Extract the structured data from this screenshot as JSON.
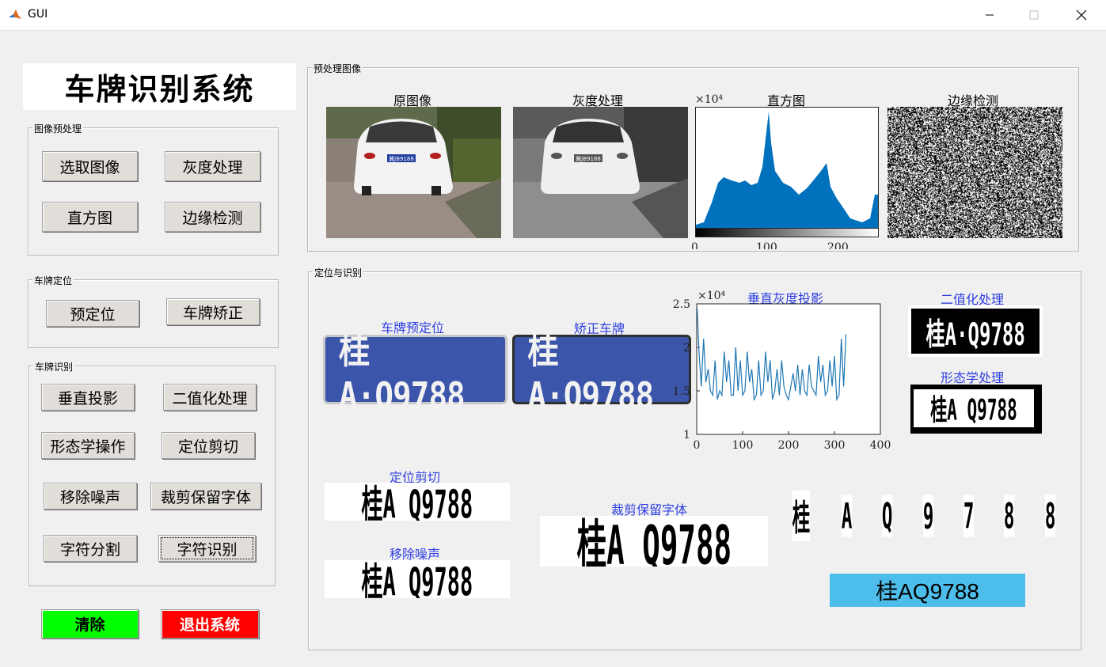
{
  "window": {
    "title": "GUI"
  },
  "app_title": "车牌识别系统",
  "panels": {
    "preprocess": "图像预处理",
    "locate": "车牌定位",
    "recognize": "车牌识别",
    "preview": "预处理图像",
    "result": "定位与识别"
  },
  "buttons": {
    "select_image": "选取图像",
    "grayscale": "灰度处理",
    "histogram": "直方图",
    "edge": "边缘检测",
    "prelocate": "预定位",
    "correct": "车牌矫正",
    "vproj": "垂直投影",
    "binarize": "二值化处理",
    "morph": "形态学操作",
    "crop": "定位剪切",
    "denoise": "移除噪声",
    "crop_keep": "裁剪保留字体",
    "segment": "字符分割",
    "recognize": "字符识别",
    "clear": "清除",
    "exit": "退出系统"
  },
  "preview_labels": {
    "original": "原图像",
    "gray": "灰度处理",
    "hist": "直方图",
    "edge": "边缘检测"
  },
  "result_labels": {
    "prelocate": "车牌预定位",
    "corrected": "矫正车牌",
    "vproj": "垂直灰度投影",
    "binary": "二值化处理",
    "morph": "形态学处理",
    "crop": "定位剪切",
    "denoise": "移除噪声",
    "crop_keep": "裁剪保留字体"
  },
  "plate_text": "桂A·Q9788",
  "plate_small": "冀JB9188",
  "bw_text": "桂A Q9788",
  "segmented_chars": [
    "桂",
    "A",
    "Q",
    "9",
    "7",
    "8",
    "8"
  ],
  "result": "桂AQ9788",
  "hist_axes": {
    "exp": "×10⁴",
    "xticks": [
      "0",
      "100",
      "200"
    ]
  },
  "chart_data": {
    "type": "line",
    "title": "垂直灰度投影",
    "exponent_label": "×10⁴",
    "xlim": [
      0,
      400
    ],
    "ylim": [
      1,
      2.5
    ],
    "xticks": [
      "0",
      "100",
      "200",
      "300",
      "400"
    ],
    "yticks": [
      "1",
      "1.5",
      "2",
      "2.5"
    ],
    "series": [
      {
        "color": "#1f77b4",
        "x": [
          1,
          5,
          10,
          15,
          20,
          25,
          30,
          35,
          40,
          45,
          50,
          55,
          60,
          65,
          70,
          75,
          80,
          85,
          90,
          95,
          100,
          105,
          110,
          115,
          120,
          125,
          130,
          135,
          140,
          145,
          150,
          155,
          160,
          165,
          170,
          175,
          180,
          185,
          190,
          195,
          200,
          205,
          210,
          215,
          220,
          225,
          230,
          235,
          240,
          245,
          250,
          255,
          260,
          265,
          270,
          275,
          280,
          285,
          290,
          295,
          300,
          305,
          310,
          315,
          320,
          325
        ],
        "y": [
          2.45,
          1.95,
          1.55,
          2.1,
          1.6,
          1.75,
          1.5,
          1.45,
          1.85,
          1.4,
          1.5,
          1.45,
          1.95,
          1.6,
          1.85,
          1.45,
          1.45,
          2.0,
          1.5,
          1.85,
          1.45,
          1.5,
          1.95,
          1.6,
          1.75,
          1.4,
          1.45,
          1.85,
          1.45,
          1.5,
          1.95,
          1.6,
          1.85,
          1.4,
          1.5,
          1.75,
          1.45,
          1.85,
          1.55,
          1.45,
          1.4,
          1.55,
          1.7,
          1.5,
          1.8,
          1.45,
          1.75,
          1.5,
          1.45,
          1.8,
          1.55,
          1.5,
          1.45,
          1.9,
          1.6,
          1.8,
          1.45,
          1.5,
          1.85,
          1.55,
          1.9,
          1.4,
          1.45,
          2.1,
          1.55,
          2.15
        ]
      }
    ]
  }
}
